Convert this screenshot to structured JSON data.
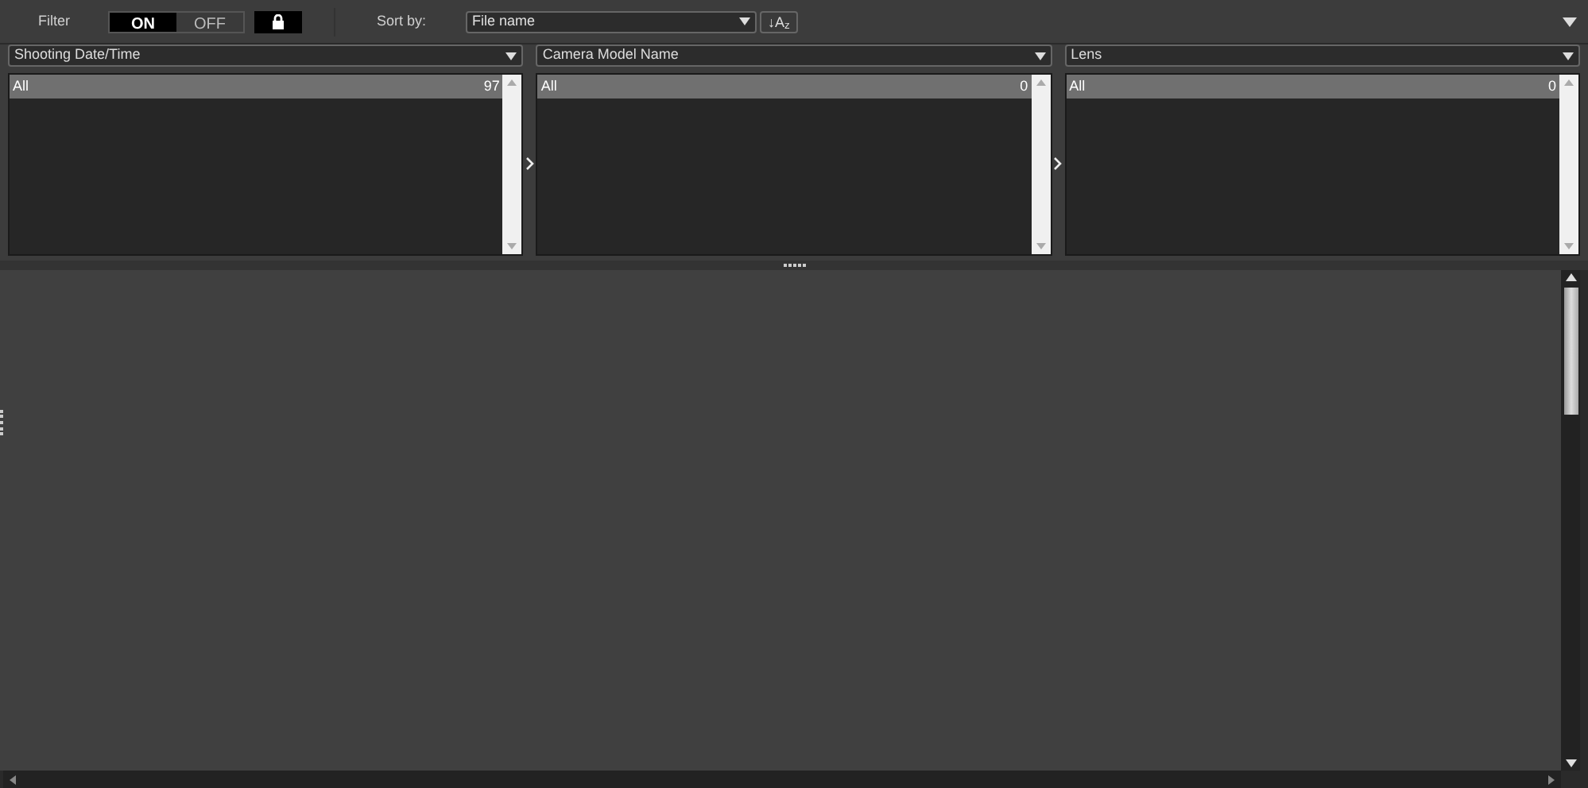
{
  "toolbar": {
    "filter_label": "Filter",
    "filter_toggle": [
      {
        "label": "ON",
        "selected": true
      },
      {
        "label": "OFF",
        "selected": false
      }
    ],
    "sort_label": "Sort by:",
    "sort_field": {
      "value": "File name"
    },
    "sort_order_button": "↓A$_{z}$"
  },
  "filter_columns": [
    {
      "category": "Shooting Date/Time",
      "rows": [
        {
          "label": "All",
          "count": "97",
          "selected": true
        }
      ]
    },
    {
      "category": "Camera Model Name",
      "rows": [
        {
          "label": "All",
          "count": "0",
          "selected": true
        }
      ]
    },
    {
      "category": "Lens",
      "rows": [
        {
          "label": "All",
          "count": "0",
          "selected": true
        }
      ]
    }
  ]
}
